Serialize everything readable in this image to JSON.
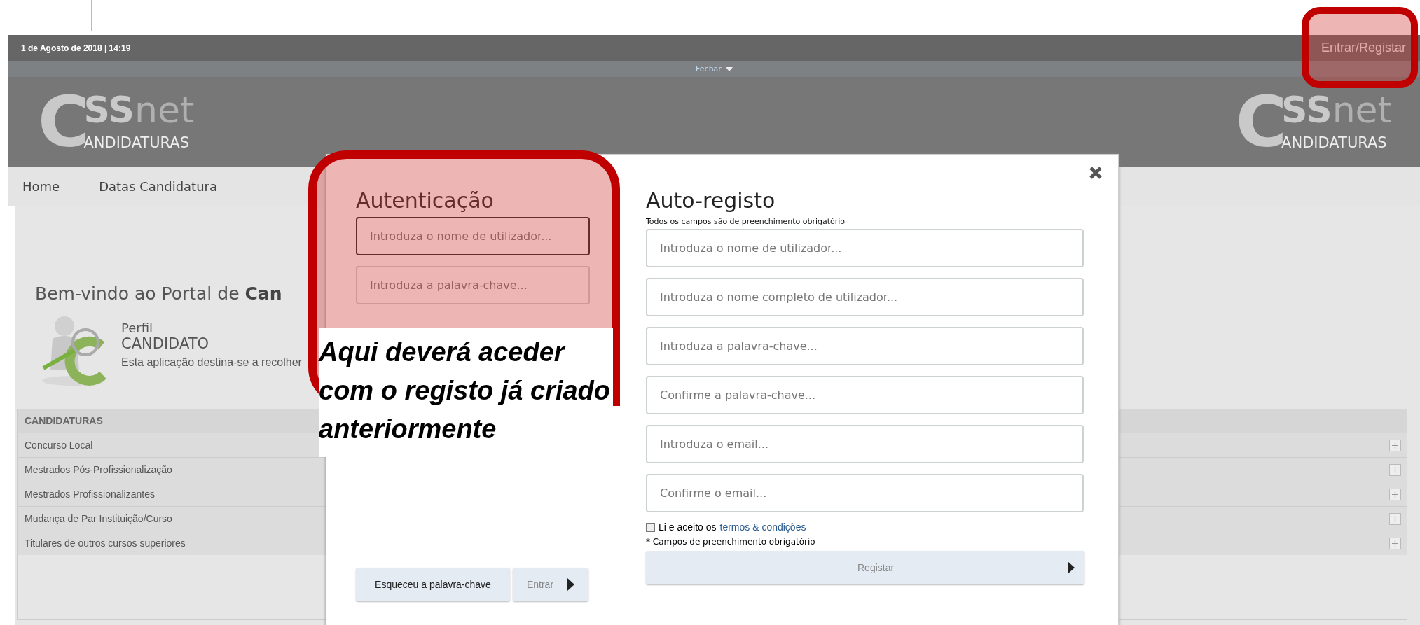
{
  "top_bar": {
    "date": "1 de Agosto de 2018 | 14:19",
    "login_link": "Entrar/Registar"
  },
  "toggle": {
    "label": "Fechar"
  },
  "logos": [
    {
      "initial": "C",
      "main": "SS",
      "suffix": "net",
      "subtitle": "ANDIDATURAS"
    },
    {
      "initial": "C",
      "main": "SS",
      "suffix": "net",
      "subtitle": "ANDIDATURAS"
    }
  ],
  "nav": [
    "Home",
    "Datas Candidatura"
  ],
  "welcome": "Bem-vindo ao Portal de **Can**",
  "profile": {
    "label": "Perfil",
    "role": "CANDIDATO",
    "description": "Esta aplicação destina-se a recolher"
  },
  "table": {
    "title": "CANDIDATURAS",
    "rows": [
      "Concurso Local",
      "Mestrados Pós-Profissionalização",
      "Mestrados Profissionalizantes",
      "Mudança de Par Instituição/Curso",
      "Titulares de outros cursos superiores"
    ]
  },
  "login": {
    "title": "Autenticação",
    "fields": [
      {
        "placeholder": "Introduza o nome de utilizador...",
        "focused": true
      },
      {
        "placeholder": "Introduza a palavra-chave...",
        "focused": false
      }
    ],
    "forgot_button": "Esqueceu a palavra-chave",
    "submit": {
      "label": "Entrar",
      "disabled": true
    }
  },
  "register": {
    "title": "Auto-registo",
    "note": "Todos os campos são de preenchimento obrigatório",
    "fields": [
      {
        "placeholder": "Introduza o nome de utilizador..."
      },
      {
        "placeholder": "Introduza o nome completo de utilizador..."
      },
      {
        "placeholder": "Introduza a palavra-chave..."
      },
      {
        "placeholder": "Confirme a palavra-chave..."
      },
      {
        "placeholder": "Introduza o email..."
      },
      {
        "placeholder": "Confirme o email..."
      }
    ],
    "terms": {
      "text": "Li e aceito os",
      "link": "termos & condições",
      "checked": false
    },
    "required_note": "* Campos de preenchimento obrigatório",
    "submit": {
      "label": "Registar",
      "disabled": true
    }
  },
  "callout": "Aqui deverá aceder com o registo já criado anteriormente"
}
